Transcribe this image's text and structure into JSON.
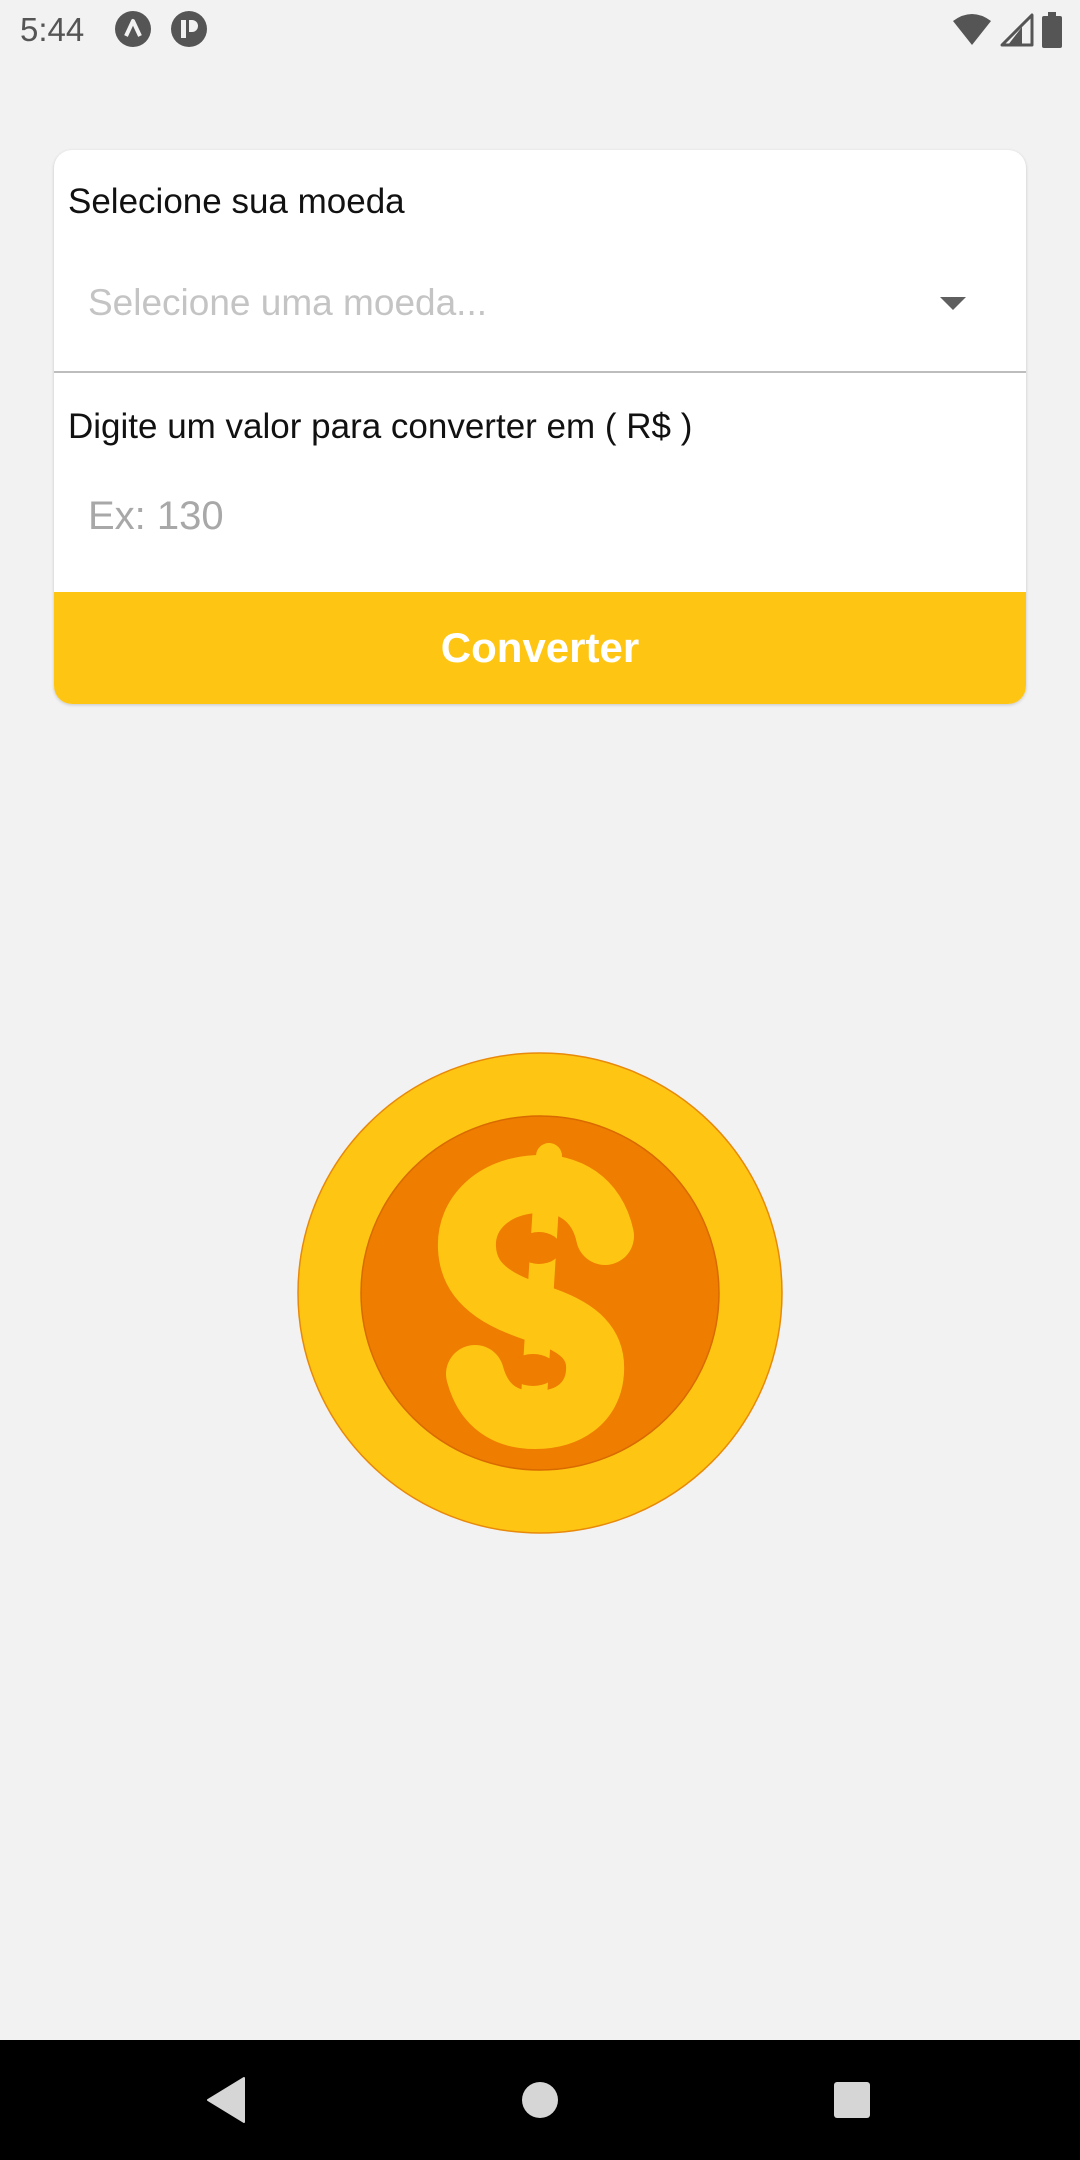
{
  "status_bar": {
    "time": "5:44",
    "icons": [
      "app-a-icon",
      "app-r-icon",
      "wifi-icon",
      "cell-signal-icon",
      "battery-icon"
    ]
  },
  "form": {
    "currency_label": "Selecione sua moeda",
    "currency_placeholder": "Selecione uma moeda...",
    "amount_label": "Digite um valor para converter em ( R$ )",
    "amount_placeholder": "Ex: 130",
    "amount_value": "",
    "convert_label": "Converter"
  },
  "illustration": {
    "icon": "dollar-coin-icon"
  },
  "nav_bar": {
    "icons": [
      "back-icon",
      "home-icon",
      "recents-icon"
    ]
  },
  "colors": {
    "accent": "#FEC613",
    "coin_inner": "#EF7D00",
    "background": "#F2F2F2"
  }
}
